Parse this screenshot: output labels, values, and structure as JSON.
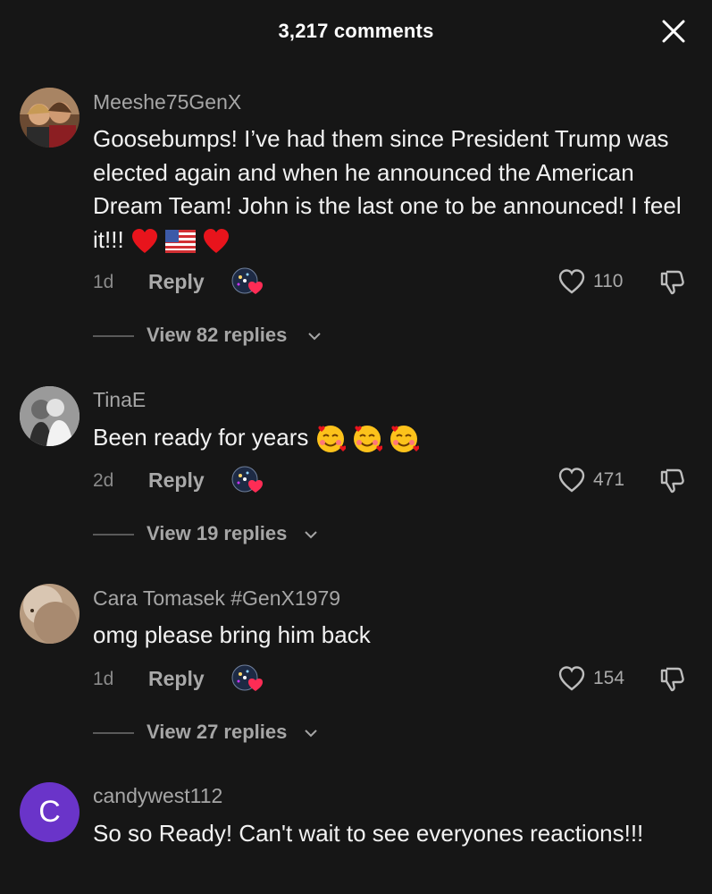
{
  "header": {
    "title": "3,217 comments"
  },
  "comments": [
    {
      "username": "Meeshe75GenX",
      "text": "Goosebumps! I’ve had them since President Trump was elected again and when he announced the American Dream Team! John is the last one to be announced! I feel it!!!",
      "emojis": [
        "red-heart",
        "us-flag",
        "red-heart"
      ],
      "time": "1d",
      "reply_label": "Reply",
      "likes": "110",
      "view_replies": "View 82 replies"
    },
    {
      "username": "TinaE",
      "text": "Been ready for years",
      "emojis": [
        "smiling-face-with-hearts",
        "smiling-face-with-hearts",
        "smiling-face-with-hearts"
      ],
      "time": "2d",
      "reply_label": "Reply",
      "likes": "471",
      "view_replies": "View 19 replies"
    },
    {
      "username": "Cara Tomasek #GenX1979",
      "text": "omg please bring him back",
      "time": "1d",
      "reply_label": "Reply",
      "likes": "154",
      "view_replies": "View 27 replies"
    },
    {
      "username": "candywest112",
      "avatar_letter": "C",
      "avatar_color": "#6a34c9",
      "text": "So so Ready! Can't wait to see everyones reactions!!!"
    }
  ],
  "colors": {
    "background": "#161616",
    "secondary_text": "#a6a6a6",
    "like_accent": "#fe2c55"
  }
}
